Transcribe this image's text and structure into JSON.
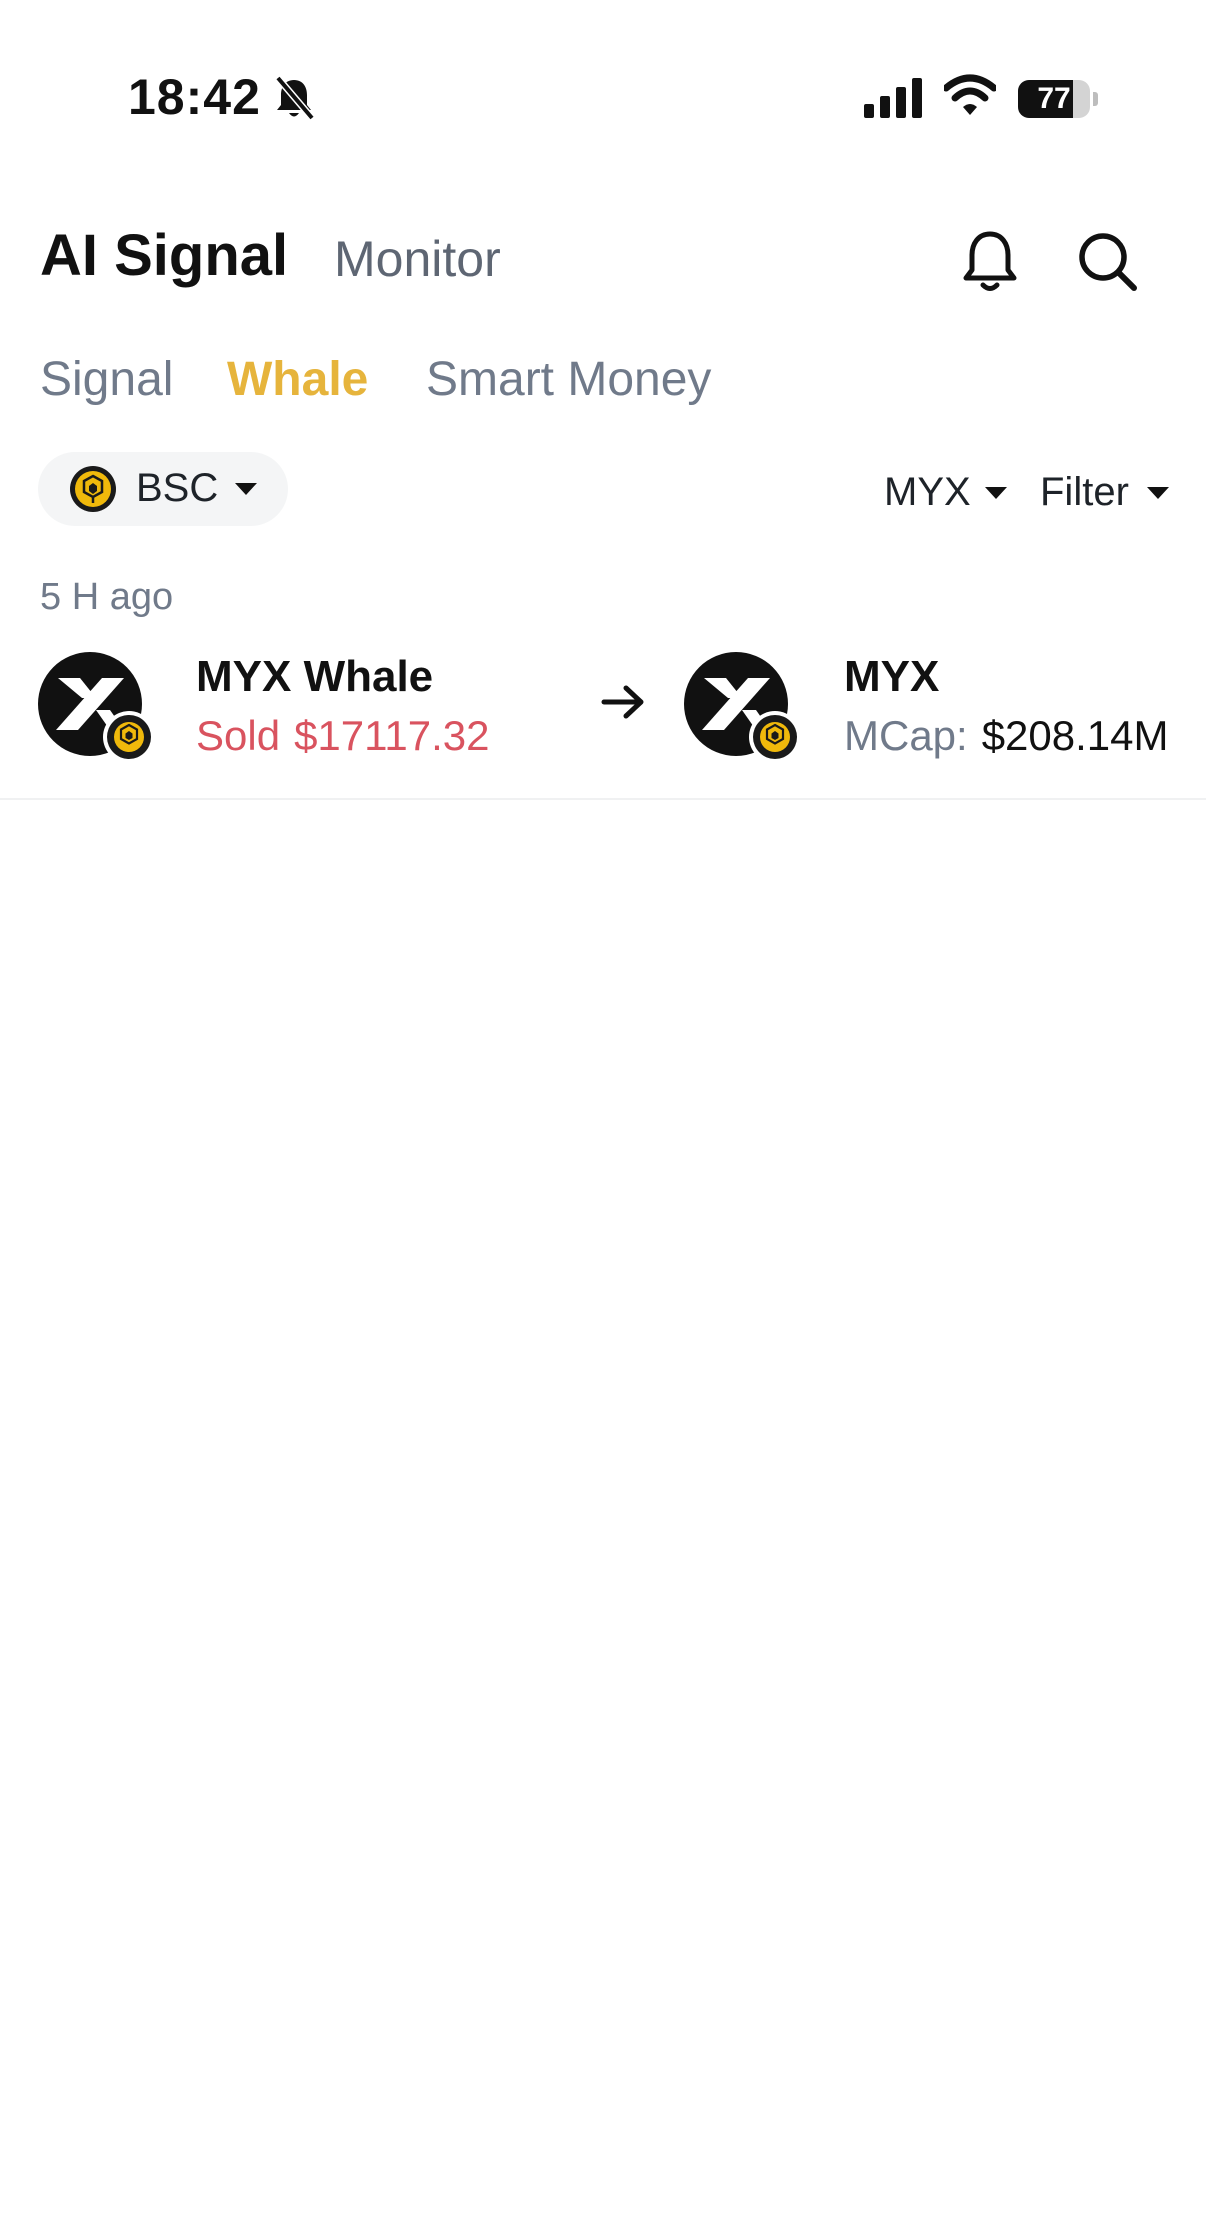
{
  "status_bar": {
    "time": "18:42",
    "battery_level": "77",
    "battery_fraction": 0.77,
    "icons": [
      "bell-slash-icon",
      "cellular-signal-icon",
      "wifi-icon",
      "battery-icon"
    ]
  },
  "header": {
    "title": "AI Signal",
    "secondary_tab": "Monitor",
    "icons": [
      "bell-icon",
      "search-icon"
    ]
  },
  "tabs": [
    {
      "label": "Signal",
      "active": false
    },
    {
      "label": "Whale",
      "active": true
    },
    {
      "label": "Smart Money",
      "active": false
    }
  ],
  "filters": {
    "chain": "BSC",
    "chain_icon": "bnb-logo-icon",
    "token": "MYX",
    "filter_label": "Filter"
  },
  "feed": [
    {
      "time_ago": "5 H ago",
      "whale_name": "MYX Whale",
      "action": "Sold",
      "amount": "$17117.32",
      "token": "MYX",
      "mcap_label": "MCap:",
      "mcap_value": "$208.14M"
    }
  ],
  "colors": {
    "accent": "#e6b43c",
    "sell": "#d9535f",
    "muted": "#707a8a",
    "chip_bg": "#f4f5f6"
  }
}
